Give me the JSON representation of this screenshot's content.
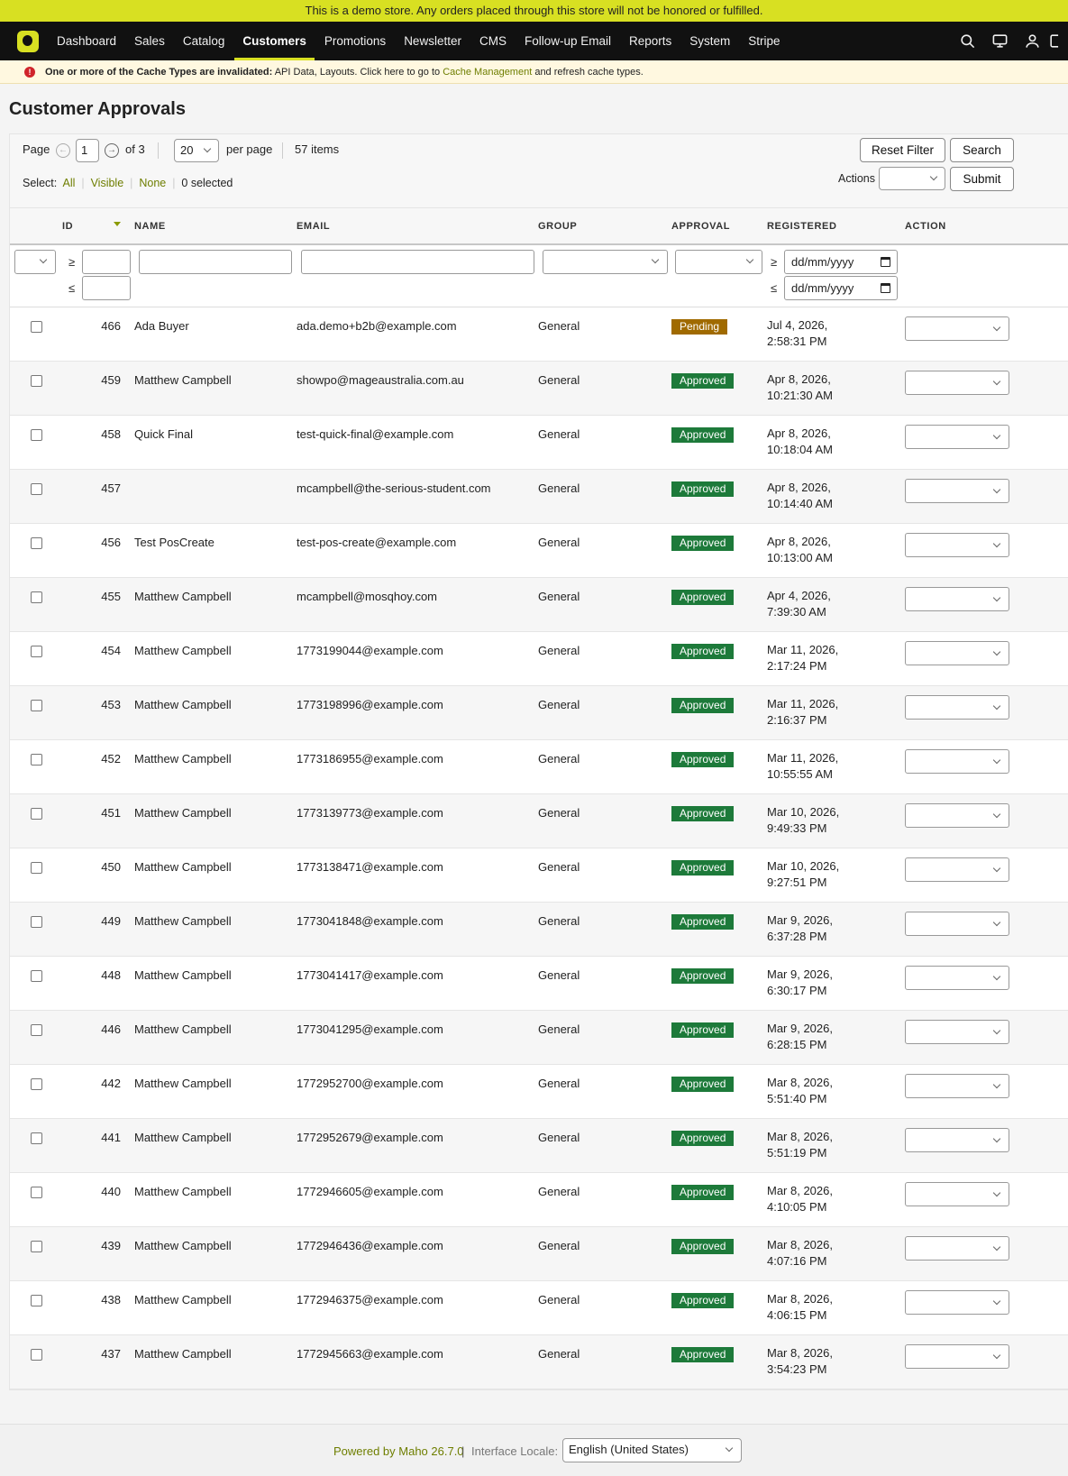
{
  "demo_notice": "This is a demo store. Any orders placed through this store will not be honored or fulfilled.",
  "nav": {
    "items": [
      "Dashboard",
      "Sales",
      "Catalog",
      "Customers",
      "Promotions",
      "Newsletter",
      "CMS",
      "Follow-up Email",
      "Reports",
      "System",
      "Stripe"
    ],
    "active": "Customers",
    "icons": [
      "search-icon",
      "monitor-icon",
      "user-icon",
      "logout-icon"
    ]
  },
  "cache_notice": {
    "bold": "One or more of the Cache Types are invalidated:",
    "text": " API Data, Layouts. Click here to go to ",
    "link": "Cache Management",
    "after": " and refresh cache types."
  },
  "page_title": "Customer Approvals",
  "pager": {
    "page_label": "Page",
    "page_value": "1",
    "of_label": "of 3",
    "per_page_value": "20",
    "per_page_label": "per page",
    "items_label": "57 items",
    "reset_filter": "Reset Filter",
    "search": "Search",
    "select_label": "Select:",
    "select_all": "All",
    "select_visible": "Visible",
    "select_none": "None",
    "selected_count": "0 selected",
    "actions_label": "Actions",
    "submit": "Submit"
  },
  "columns": [
    "ID",
    "NAME",
    "EMAIL",
    "GROUP",
    "APPROVAL",
    "REGISTERED",
    "ACTION"
  ],
  "filters": {
    "gte": "≥",
    "lte": "≤",
    "date_placeholder": "dd/mm/yyyy"
  },
  "rows": [
    {
      "id": "466",
      "name": "Ada Buyer",
      "email": "ada.demo+b2b@example.com",
      "group": "General",
      "approval": "Pending",
      "date": "Jul 4, 2026,",
      "time": "2:58:31 PM"
    },
    {
      "id": "459",
      "name": "Matthew Campbell",
      "email": "showpo@mageaustralia.com.au",
      "group": "General",
      "approval": "Approved",
      "date": "Apr 8, 2026,",
      "time": "10:21:30 AM"
    },
    {
      "id": "458",
      "name": "Quick Final",
      "email": "test-quick-final@example.com",
      "group": "General",
      "approval": "Approved",
      "date": "Apr 8, 2026,",
      "time": "10:18:04 AM"
    },
    {
      "id": "457",
      "name": "",
      "email": "mcampbell@the-serious-student.com",
      "group": "General",
      "approval": "Approved",
      "date": "Apr 8, 2026,",
      "time": "10:14:40 AM"
    },
    {
      "id": "456",
      "name": "Test PosCreate",
      "email": "test-pos-create@example.com",
      "group": "General",
      "approval": "Approved",
      "date": "Apr 8, 2026,",
      "time": "10:13:00 AM"
    },
    {
      "id": "455",
      "name": "Matthew Campbell",
      "email": "mcampbell@mosqhoy.com",
      "group": "General",
      "approval": "Approved",
      "date": "Apr 4, 2026,",
      "time": "7:39:30 AM"
    },
    {
      "id": "454",
      "name": "Matthew Campbell",
      "email": "1773199044@example.com",
      "group": "General",
      "approval": "Approved",
      "date": "Mar 11, 2026,",
      "time": "2:17:24 PM"
    },
    {
      "id": "453",
      "name": "Matthew Campbell",
      "email": "1773198996@example.com",
      "group": "General",
      "approval": "Approved",
      "date": "Mar 11, 2026,",
      "time": "2:16:37 PM"
    },
    {
      "id": "452",
      "name": "Matthew Campbell",
      "email": "1773186955@example.com",
      "group": "General",
      "approval": "Approved",
      "date": "Mar 11, 2026,",
      "time": "10:55:55 AM"
    },
    {
      "id": "451",
      "name": "Matthew Campbell",
      "email": "1773139773@example.com",
      "group": "General",
      "approval": "Approved",
      "date": "Mar 10, 2026,",
      "time": "9:49:33 PM"
    },
    {
      "id": "450",
      "name": "Matthew Campbell",
      "email": "1773138471@example.com",
      "group": "General",
      "approval": "Approved",
      "date": "Mar 10, 2026,",
      "time": "9:27:51 PM"
    },
    {
      "id": "449",
      "name": "Matthew Campbell",
      "email": "1773041848@example.com",
      "group": "General",
      "approval": "Approved",
      "date": "Mar 9, 2026,",
      "time": "6:37:28 PM"
    },
    {
      "id": "448",
      "name": "Matthew Campbell",
      "email": "1773041417@example.com",
      "group": "General",
      "approval": "Approved",
      "date": "Mar 9, 2026,",
      "time": "6:30:17 PM"
    },
    {
      "id": "446",
      "name": "Matthew Campbell",
      "email": "1773041295@example.com",
      "group": "General",
      "approval": "Approved",
      "date": "Mar 9, 2026,",
      "time": "6:28:15 PM"
    },
    {
      "id": "442",
      "name": "Matthew Campbell",
      "email": "1772952700@example.com",
      "group": "General",
      "approval": "Approved",
      "date": "Mar 8, 2026,",
      "time": "5:51:40 PM"
    },
    {
      "id": "441",
      "name": "Matthew Campbell",
      "email": "1772952679@example.com",
      "group": "General",
      "approval": "Approved",
      "date": "Mar 8, 2026,",
      "time": "5:51:19 PM"
    },
    {
      "id": "440",
      "name": "Matthew Campbell",
      "email": "1772946605@example.com",
      "group": "General",
      "approval": "Approved",
      "date": "Mar 8, 2026,",
      "time": "4:10:05 PM"
    },
    {
      "id": "439",
      "name": "Matthew Campbell",
      "email": "1772946436@example.com",
      "group": "General",
      "approval": "Approved",
      "date": "Mar 8, 2026,",
      "time": "4:07:16 PM"
    },
    {
      "id": "438",
      "name": "Matthew Campbell",
      "email": "1772946375@example.com",
      "group": "General",
      "approval": "Approved",
      "date": "Mar 8, 2026,",
      "time": "4:06:15 PM"
    },
    {
      "id": "437",
      "name": "Matthew Campbell",
      "email": "1772945663@example.com",
      "group": "General",
      "approval": "Approved",
      "date": "Mar 8, 2026,",
      "time": "3:54:23 PM"
    }
  ],
  "footer": {
    "powered_by": "Powered by Maho 26.7.0",
    "separator": "|",
    "locale_label": "Interface Locale:",
    "locale_value": "English (United States)"
  },
  "colors": {
    "accent": "#d8e022",
    "approved": "#1d7a3a",
    "pending": "#a06a00",
    "link": "#6e7e00",
    "nav_bg": "#111111"
  }
}
